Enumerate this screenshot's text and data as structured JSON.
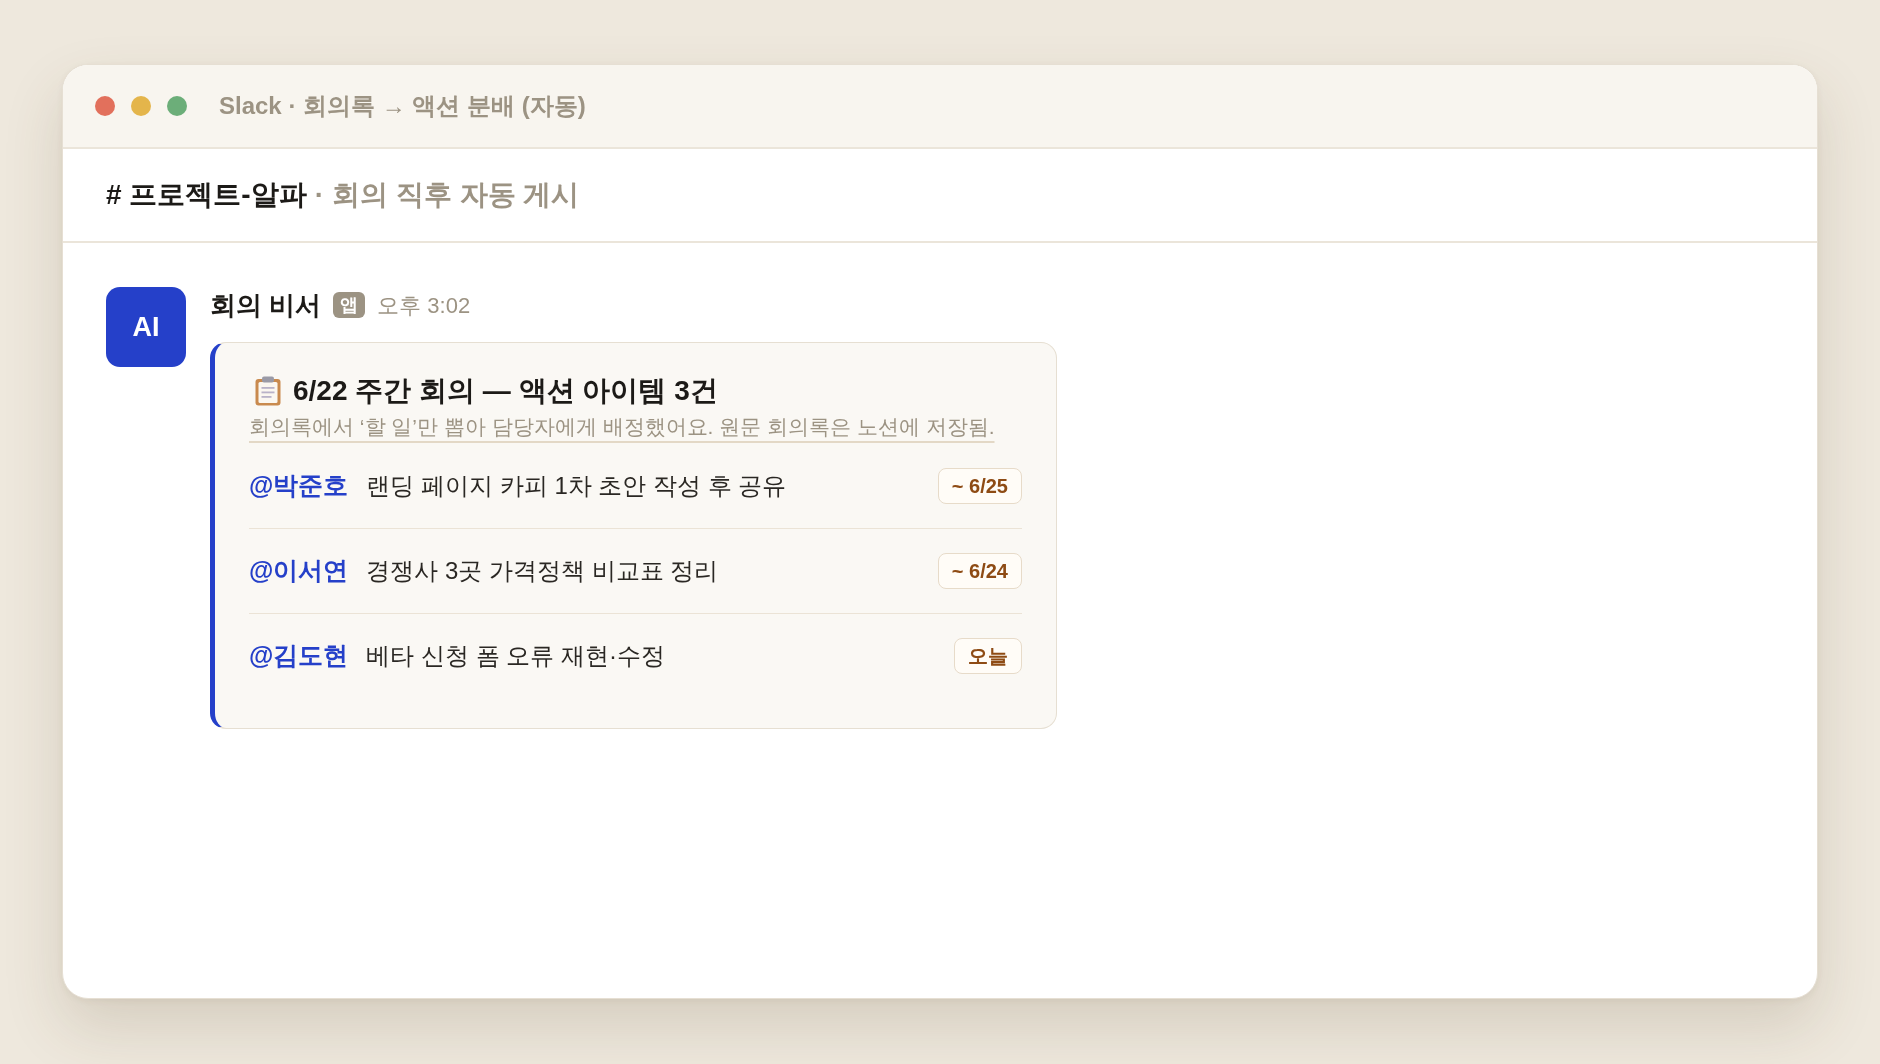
{
  "window": {
    "title": "Slack · 회의록 → 액션 분배 (자동)"
  },
  "channel_header": {
    "channel": "# 프로젝트-알파",
    "separator": "·",
    "description": "회의 직후 자동 게시"
  },
  "message": {
    "avatar": "AI",
    "sender": "회의 비서",
    "sender_badge": "앱",
    "time": "오후 3:02",
    "attachment": {
      "title": "6/22 주간 회의 — 액션 아이템 3건",
      "subtitle": "회의록에서 ‘할 일’만 뽑아 담당자에게 배정했어요. 원문 회의록은 노션에 저장됨.",
      "items": [
        {
          "assignee": "@박준호",
          "task": "랜딩 페이지 카피 1차 초안 작성 후 공유",
          "due": "~ 6/25"
        },
        {
          "assignee": "@이서연",
          "task": "경쟁사 3곳 가격정책 비교표 정리",
          "due": "~ 6/24"
        },
        {
          "assignee": "@김도현",
          "task": "베타 신청 폼 오류 재현·수정",
          "due": "오늘"
        }
      ]
    }
  }
}
